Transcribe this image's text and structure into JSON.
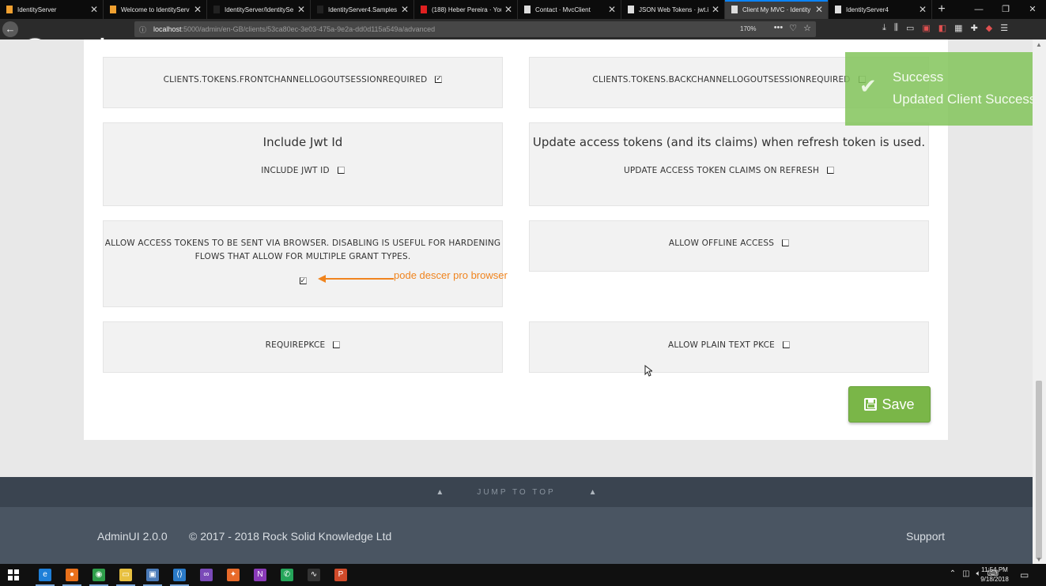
{
  "browser": {
    "tabs": [
      {
        "title": "IdentityServer",
        "favicon_color": "#f0a030"
      },
      {
        "title": "Welcome to IdentityServ",
        "favicon_color": "#f0a030"
      },
      {
        "title": "IdentityServer/IdentitySe",
        "favicon_color": "#222222"
      },
      {
        "title": "IdentityServer4.Samples",
        "favicon_color": "#222222"
      },
      {
        "title": "(188) Heber Pereira · You",
        "favicon_color": "#e02020"
      },
      {
        "title": "Contact · MvcClient",
        "favicon_color": "#dddddd"
      },
      {
        "title": "JSON Web Tokens · jwt.io",
        "favicon_color": "#dddddd"
      },
      {
        "title": "Client My MVC · Identity Ex",
        "favicon_color": "#dddddd"
      },
      {
        "title": "IdentityServer4",
        "favicon_color": "#dddddd"
      }
    ],
    "active_tab_index": 7,
    "url_host": "localhost",
    "url_rest": ":5000/admin/en-GB/clients/53ca80ec-3e03-475a-9e2a-dd0d115a549a/advanced",
    "zoom": "170%",
    "overlay_logo": "Google"
  },
  "settings": {
    "front_channel": {
      "label": "CLIENTS.TOKENS.FRONTCHANNELLOGOUTSESSIONREQUIRED",
      "checked": true
    },
    "back_channel": {
      "label": "CLIENTS.TOKENS.BACKCHANNELLOGOUTSESSIONREQUIRED",
      "checked": false
    },
    "include_jwt": {
      "heading": "Include Jwt Id",
      "label": "INCLUDE JWT ID",
      "checked": false
    },
    "update_claims": {
      "heading": "Update access tokens (and its claims) when refresh token is used.",
      "label": "UPDATE ACCESS TOKEN CLAIMS ON REFRESH",
      "checked": false
    },
    "browser_tokens": {
      "label_line1": "ALLOW ACCESS TOKENS TO BE SENT VIA BROWSER. DISABLING IS USEFUL FOR HARDENING",
      "label_line2": "FLOWS THAT ALLOW FOR MULTIPLE GRANT TYPES.",
      "checked": true
    },
    "offline_access": {
      "label": "ALLOW OFFLINE ACCESS",
      "checked": false
    },
    "require_pkce": {
      "label": "REQUIREPKCE",
      "checked": false
    },
    "plain_text_pkce": {
      "label": "ALLOW PLAIN TEXT PKCE",
      "checked": false
    }
  },
  "annotation": {
    "text": "pode descer pro browser",
    "color": "#f0841e"
  },
  "save_button": {
    "label": "Save",
    "color": "#7ab648"
  },
  "toast": {
    "title": "Success",
    "message": "Updated Client Successfully",
    "color": "#82c45a"
  },
  "footer": {
    "jump_to_top": "JUMP TO TOP",
    "version": "AdminUI 2.0.0",
    "copyright": "© 2017 - 2018 Rock Solid Knowledge Ltd",
    "support": "Support"
  },
  "taskbar": {
    "apps": [
      {
        "name": "edge-icon",
        "color": "#1e7fd8",
        "glyph": "e"
      },
      {
        "name": "firefox-icon",
        "color": "#e8701a",
        "glyph": "●"
      },
      {
        "name": "chrome-icon",
        "color": "#2e9e4a",
        "glyph": "◉"
      },
      {
        "name": "file-explorer-icon",
        "color": "#e8c040",
        "glyph": "▭"
      },
      {
        "name": "remote-desktop-icon",
        "color": "#4a7ab8",
        "glyph": "▣"
      },
      {
        "name": "vscode-icon",
        "color": "#2a7ac8",
        "glyph": "⟨⟩"
      },
      {
        "name": "visual-studio-icon",
        "color": "#7a4ab8",
        "glyph": "∞"
      },
      {
        "name": "postman-icon",
        "color": "#e86a2a",
        "glyph": "✦"
      },
      {
        "name": "onenote-icon",
        "color": "#8a3ab8",
        "glyph": "N"
      },
      {
        "name": "whatsapp-icon",
        "color": "#25a55a",
        "glyph": "✆"
      },
      {
        "name": "activity-monitor-icon",
        "color": "#333333",
        "glyph": "∿"
      },
      {
        "name": "powerpoint-icon",
        "color": "#d04a2a",
        "glyph": "P"
      }
    ],
    "time": "11:54 PM",
    "date": "9/18/2018"
  }
}
